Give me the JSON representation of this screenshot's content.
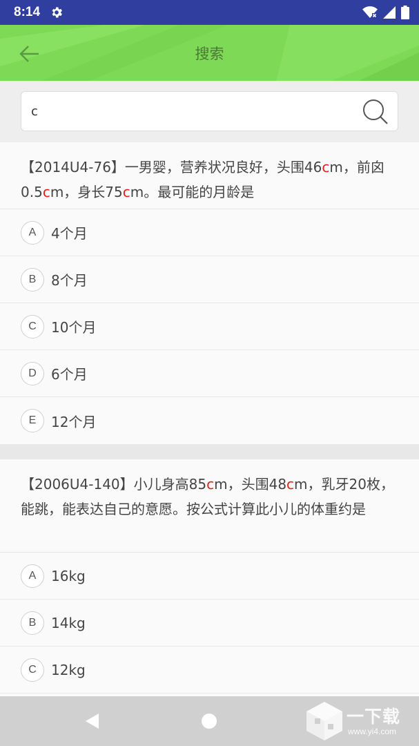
{
  "status_bar": {
    "time": "8:14",
    "icons": [
      "gear-icon",
      "wifi-icon",
      "signal-icon",
      "battery-icon"
    ]
  },
  "app_bar": {
    "title": "搜索",
    "back_icon": "back-arrow-icon",
    "color": "#7ed957"
  },
  "search": {
    "value": "c",
    "icon": "search-icon"
  },
  "highlight_color": "#e02020",
  "questions": [
    {
      "stem_parts": [
        "【2014U4-76】一男婴，营养状况良好，头围46",
        "c",
        "m，前囟0.5",
        "c",
        "m，身长75",
        "c",
        "m。最可能的月龄是"
      ],
      "options": [
        {
          "letter": "A",
          "text": "4个月"
        },
        {
          "letter": "B",
          "text": "8个月"
        },
        {
          "letter": "C",
          "text": "10个月"
        },
        {
          "letter": "D",
          "text": "6个月"
        },
        {
          "letter": "E",
          "text": "12个月"
        }
      ]
    },
    {
      "stem_parts": [
        "【2006U4-140】小儿身高85",
        "c",
        "m，头围48",
        "c",
        "m，乳牙20枚，能跳，能表达自己的意愿。按公式计算此小儿的体重约是"
      ],
      "options": [
        {
          "letter": "A",
          "text": "16kg"
        },
        {
          "letter": "B",
          "text": "14kg"
        },
        {
          "letter": "C",
          "text": "12kg"
        }
      ]
    }
  ],
  "nav_bar": {
    "icons": [
      "nav-back-icon",
      "nav-home-icon"
    ]
  },
  "watermark": {
    "text": "一下载",
    "url": "www.yi4.com"
  }
}
